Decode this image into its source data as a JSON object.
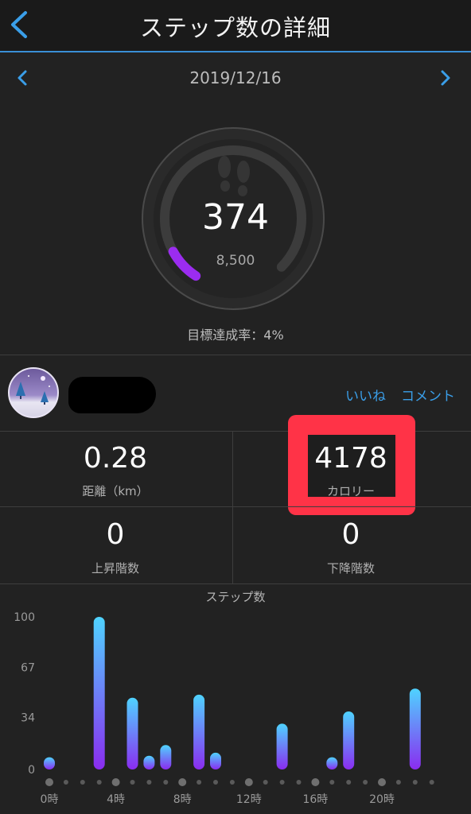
{
  "header": {
    "title": "ステップ数の詳細",
    "back_icon": "chevron-left-icon"
  },
  "date_nav": {
    "date": "2019/12/16",
    "prev_icon": "chevron-left-icon",
    "next_icon": "chevron-right-icon"
  },
  "summary": {
    "steps": "374",
    "goal": "8,500",
    "goal_rate_text": "目標達成率：4%",
    "progress_fraction": 0.04,
    "icon": "footprints-icon"
  },
  "social": {
    "like_label": "いいね",
    "comment_label": "コメント"
  },
  "stats": {
    "distance_value": "0.28",
    "distance_label": "距離（km）",
    "calories_value": "4178",
    "calories_label": "カロリー",
    "floors_up_value": "0",
    "floors_up_label": "上昇階数",
    "floors_down_value": "0",
    "floors_down_label": "下降階数"
  },
  "colors": {
    "accent": "#3a9ee8",
    "progress": "#9b2cf0",
    "highlight": "#ff3347",
    "bar_top": "#4fd3ff",
    "bar_bottom": "#8a2cf0"
  },
  "chart_data": {
    "type": "bar",
    "title": "ステップ数",
    "y_ticks": [
      "100",
      "67",
      "34",
      "0"
    ],
    "ylim": [
      0,
      100
    ],
    "x_tick_labels": [
      "0時",
      "4時",
      "8時",
      "12時",
      "16時",
      "20時"
    ],
    "x_tick_hours": [
      0,
      4,
      8,
      12,
      16,
      20
    ],
    "x": [
      0,
      1,
      2,
      3,
      4,
      5,
      6,
      7,
      8,
      9,
      10,
      11,
      12,
      13,
      14,
      15,
      16,
      17,
      18,
      19,
      20,
      21,
      22,
      23
    ],
    "values": [
      8,
      0,
      0,
      100,
      0,
      47,
      9,
      16,
      0,
      49,
      11,
      0,
      0,
      0,
      30,
      0,
      0,
      8,
      38,
      0,
      0,
      0,
      53,
      0
    ],
    "grid": false
  }
}
